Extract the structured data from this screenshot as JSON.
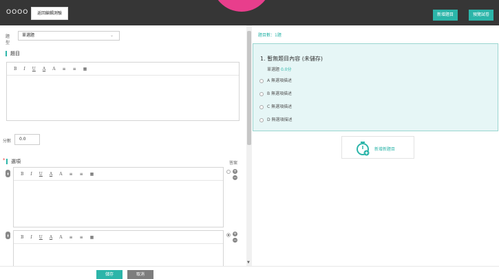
{
  "header": {
    "title": "OOOO",
    "back_label": "返回編輯測驗",
    "add_question_label": "新增題目",
    "preview_label": "預覽試卷"
  },
  "editor_panel": {
    "type_label": "題型",
    "type_value": "單選題",
    "question_label": "題目",
    "toolbar": [
      "B",
      "I",
      "U",
      "A",
      "A",
      "≡",
      "≡",
      "▦"
    ],
    "score_label": "分數",
    "score_value": "0.0",
    "options_label": "選項",
    "answer_label": "答案"
  },
  "footer": {
    "save_label": "儲存",
    "cancel_label": "取消"
  },
  "preview": {
    "count_text": "題目數：1題",
    "question_title": "1.  暫無題目內容 (未儲存)",
    "type_text": "單選題",
    "score_text": "0.0分",
    "options": [
      "A 無選項描述",
      "B 無選項描述",
      "C 無選項描述",
      "D 無選項描述"
    ],
    "add_question_label": "新增新題目"
  },
  "colors": {
    "accent": "#2cb5a9",
    "header_bg": "#363636",
    "preview_bg": "#e6f6f6",
    "pink_blob": "#e83e8c"
  }
}
